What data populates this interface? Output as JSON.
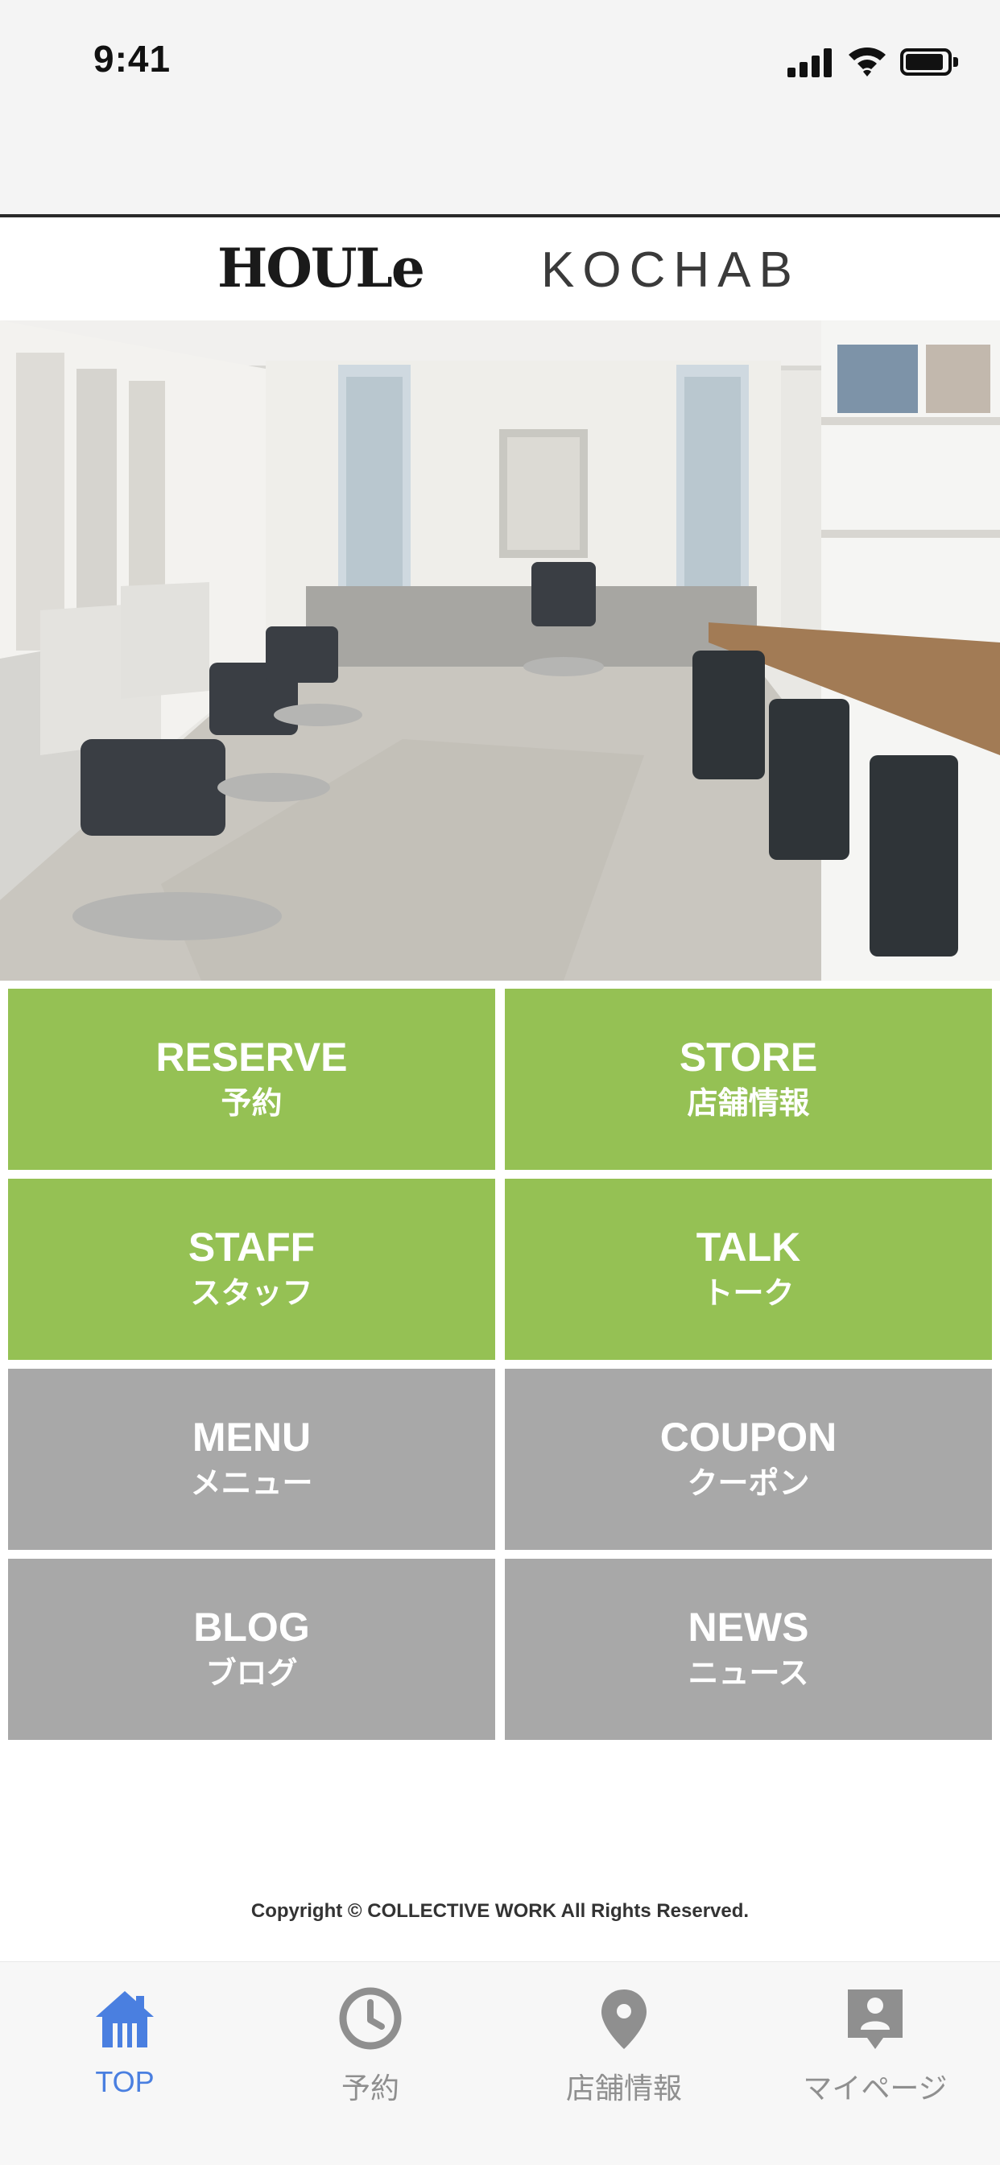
{
  "status_bar": {
    "time": "9:41"
  },
  "header": {
    "brand_left": "HOULe",
    "brand_right": "KOCHAB"
  },
  "menu_tiles": [
    {
      "en": "RESERVE",
      "ja": "予約",
      "color": "#95c154"
    },
    {
      "en": "STORE",
      "ja": "店舗情報",
      "color": "#95c154"
    },
    {
      "en": "STAFF",
      "ja": "スタッフ",
      "color": "#95c154"
    },
    {
      "en": "TALK",
      "ja": "トーク",
      "color": "#95c154"
    },
    {
      "en": "MENU",
      "ja": "メニュー",
      "color": "#a8a8a8"
    },
    {
      "en": "COUPON",
      "ja": "クーポン",
      "color": "#a8a8a8"
    },
    {
      "en": "BLOG",
      "ja": "ブログ",
      "color": "#a8a8a8"
    },
    {
      "en": "NEWS",
      "ja": "ニュース",
      "color": "#a8a8a8"
    }
  ],
  "footer": {
    "copyright": "Copyright © COLLECTIVE WORK All Rights Reserved."
  },
  "tab_bar": {
    "active_color": "#4a7fe0",
    "inactive_color": "#8f8f8f",
    "items": [
      {
        "label": "TOP",
        "icon": "home-icon",
        "active": true
      },
      {
        "label": "予約",
        "icon": "clock-icon",
        "active": false
      },
      {
        "label": "店舗情報",
        "icon": "map-pin-icon",
        "active": false
      },
      {
        "label": "マイページ",
        "icon": "profile-badge-icon",
        "active": false
      }
    ]
  }
}
